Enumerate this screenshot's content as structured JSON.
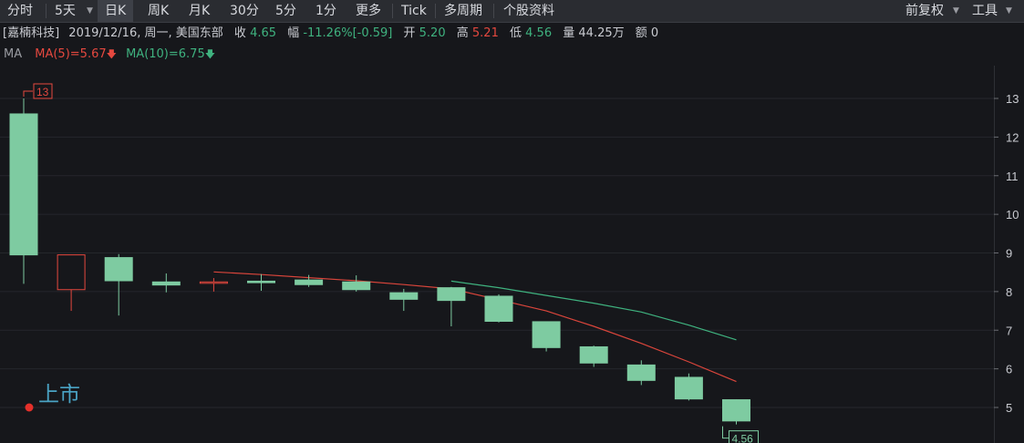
{
  "toolbar": {
    "tabs": [
      {
        "label": "分时"
      },
      {
        "label": "5天"
      },
      {
        "label": "日K"
      },
      {
        "label": "周K"
      },
      {
        "label": "月K"
      },
      {
        "label": "30分"
      },
      {
        "label": "5分"
      },
      {
        "label": "1分"
      },
      {
        "label": "更多"
      },
      {
        "label": "Tick"
      },
      {
        "label": "多周期"
      },
      {
        "label": "个股资料"
      }
    ],
    "right": {
      "adjust_label": "前复权",
      "tools_label": "工具"
    },
    "active_tab": "日K"
  },
  "info": {
    "name": "[嘉楠科技]",
    "datetime": "2019/12/16, 周一, 美国东部",
    "close_label": "收",
    "close": "4.65",
    "change_label": "幅",
    "change_pct": "-11.26%",
    "change": "[-0.59]",
    "open_label": "开",
    "open": "5.20",
    "high_label": "高",
    "high": "5.21",
    "low_label": "低",
    "low": "4.56",
    "volume_label": "量",
    "volume": "44.25万",
    "amount_label": "额",
    "amount": "0"
  },
  "ma_bar": {
    "label": "MA",
    "ma5": "MA(5)=5.67",
    "ma10": "MA(10)=6.75"
  },
  "colors": {
    "up": "#e5483f",
    "down": "#7ecba1",
    "ma5": "#d9453b",
    "ma10": "#3fb27f",
    "background": "#16171b"
  },
  "chart_data": {
    "type": "candlestick",
    "ylim": [
      4.3,
      13.5
    ],
    "yticks": [
      "5",
      "6",
      "7",
      "8",
      "9",
      "10",
      "11",
      "12",
      "13"
    ],
    "candles": [
      {
        "open": 12.6,
        "close": 8.95,
        "high": 13.0,
        "low": 8.2
      },
      {
        "open": 8.05,
        "close": 8.95,
        "high": 8.95,
        "low": 7.5
      },
      {
        "open": 8.88,
        "close": 8.28,
        "high": 8.97,
        "low": 7.38
      },
      {
        "open": 8.25,
        "close": 8.17,
        "high": 8.47,
        "low": 7.98
      },
      {
        "open": 8.22,
        "close": 8.25,
        "high": 8.35,
        "low": 8.0
      },
      {
        "open": 8.27,
        "close": 8.23,
        "high": 8.45,
        "low": 8.02
      },
      {
        "open": 8.3,
        "close": 8.18,
        "high": 8.43,
        "low": 8.12
      },
      {
        "open": 8.25,
        "close": 8.05,
        "high": 8.42,
        "low": 8.0
      },
      {
        "open": 7.97,
        "close": 7.8,
        "high": 8.07,
        "low": 7.5
      },
      {
        "open": 8.1,
        "close": 7.77,
        "high": 8.12,
        "low": 7.1
      },
      {
        "open": 7.88,
        "close": 7.23,
        "high": 7.93,
        "low": 7.2
      },
      {
        "open": 7.22,
        "close": 6.55,
        "high": 7.22,
        "low": 6.45
      },
      {
        "open": 6.57,
        "close": 6.15,
        "high": 6.6,
        "low": 6.05
      },
      {
        "open": 6.1,
        "close": 5.7,
        "high": 6.22,
        "low": 5.58
      },
      {
        "open": 5.78,
        "close": 5.22,
        "high": 5.88,
        "low": 5.18
      },
      {
        "open": 5.2,
        "close": 4.65,
        "high": 5.21,
        "low": 4.56
      }
    ],
    "ma5": [
      null,
      null,
      null,
      null,
      8.51,
      8.44,
      8.36,
      8.28,
      8.18,
      8.07,
      7.79,
      7.5,
      7.1,
      6.66,
      6.18,
      5.67
    ],
    "ma10": [
      null,
      null,
      null,
      null,
      null,
      null,
      null,
      null,
      null,
      8.27,
      8.1,
      7.9,
      7.7,
      7.47,
      7.13,
      6.75
    ],
    "annotations": {
      "high_marker": "13",
      "low_marker": "4.56",
      "listing_label": "上市"
    }
  }
}
